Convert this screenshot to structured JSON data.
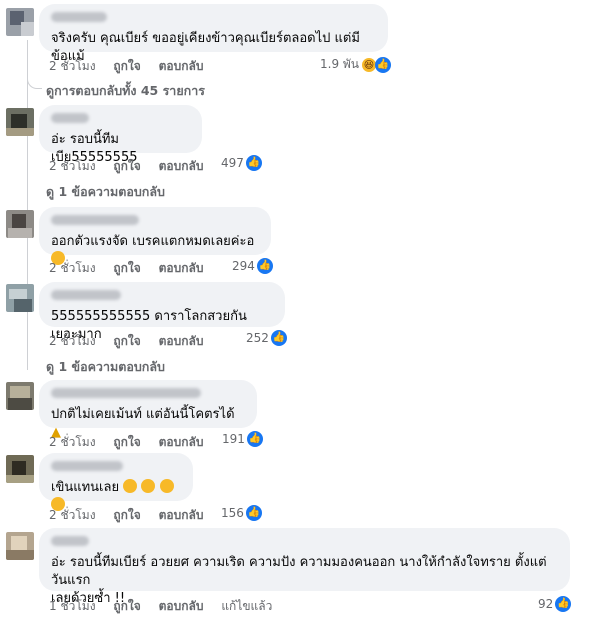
{
  "comments": [
    {
      "text": "จริงครับ คุณเบียร์ ขออยู่เคียงข้าวคุณเบียร์ตลอดไป แต่มีข้อแม้",
      "time": "2 ชั่วโมง",
      "like": "ถูกใจ",
      "reply": "ตอบกลับ",
      "reactions": "1.9 พัน"
    },
    {
      "text": "อ่ะ รอบนี้ทีมเบีย55555555",
      "time": "2 ชั่วโมง",
      "like": "ถูกใจ",
      "reply": "ตอบกลับ",
      "reactions": "497"
    },
    {
      "text": "ออกตัวแรงจัด เบรคแตกหมดเลยค่ะอ",
      "time": "2 ชั่วโมง",
      "like": "ถูกใจ",
      "reply": "ตอบกลับ",
      "reactions": "294"
    },
    {
      "text": "555555555555 ดาราโลกสวยกันเยอะมาก",
      "time": "2 ชั่วโมง",
      "like": "ถูกใจ",
      "reply": "ตอบกลับ",
      "reactions": "252"
    },
    {
      "text": "ปกติไม่เคยเม้นท์ แต่อันนี้โคตรได้",
      "time": "2 ชั่วโมง",
      "like": "ถูกใจ",
      "reply": "ตอบกลับ",
      "reactions": "191"
    },
    {
      "text": "เขินแทนเลย",
      "time": "2 ชั่วโมง",
      "like": "ถูกใจ",
      "reply": "ตอบกลับ",
      "reactions": "156"
    },
    {
      "text": "อ่ะ รอบนี้ทีมเบียร์ อวยยศ ความเริด ความปัง ความมองคนออก นางให้กำลังใจทราย ตั้งแต่วันแรก\nเลยด้วยซ้ำ !!",
      "time": "1 ชั่วโมง",
      "like": "ถูกใจ",
      "reply": "ตอบกลับ",
      "edited": "แก้ไขแล้ว",
      "reactions": "92"
    }
  ],
  "reply_links": {
    "all_replies": "ดูการตอบกลับทั้ง 45 รายการ",
    "one_reply_a": "ดู 1 ข้อความตอบกลับ",
    "one_reply_b": "ดู 1 ข้อความตอบกลับ"
  },
  "colors": {
    "bubble": "#f0f2f5",
    "meta": "#65676b",
    "like_blue": "#1877f2"
  }
}
